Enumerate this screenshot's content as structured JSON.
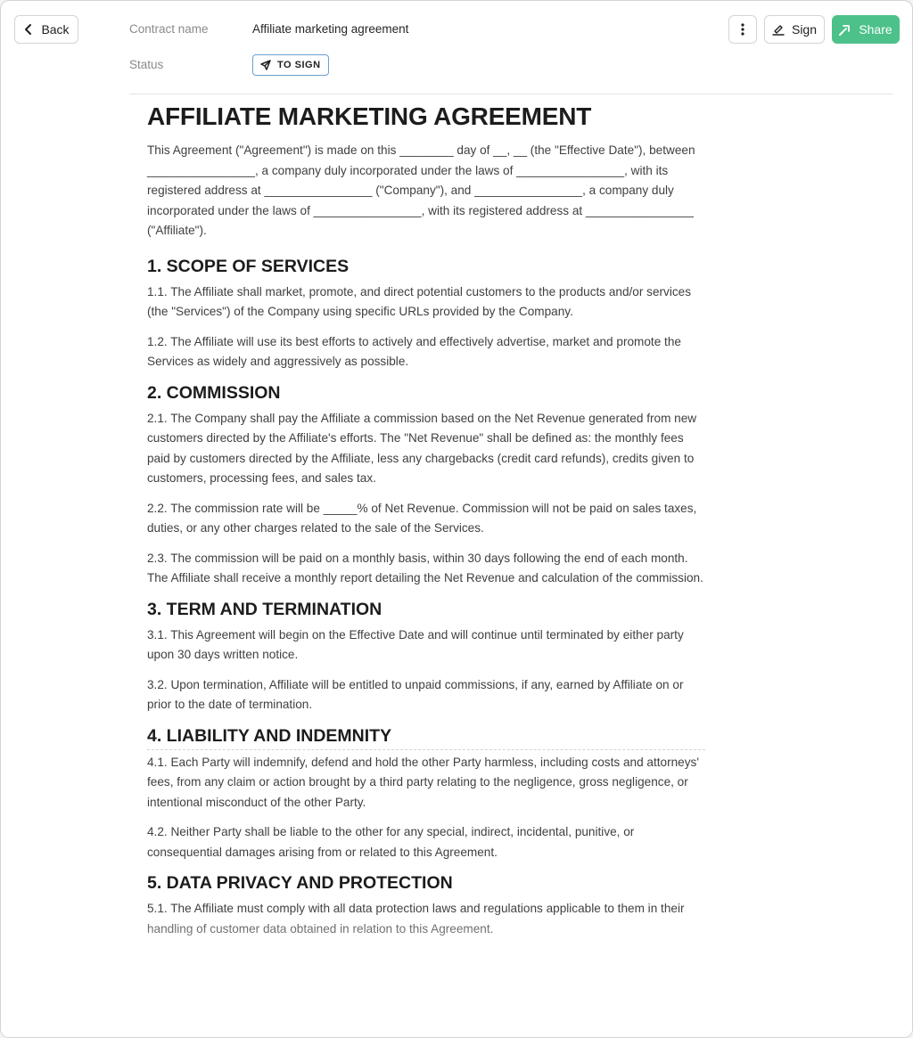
{
  "header": {
    "back_label": "Back",
    "sign_label": "Sign",
    "share_label": "Share",
    "contract_name_label": "Contract name",
    "contract_name_value": "Affiliate marketing agreement",
    "status_label": "Status",
    "status_value": "TO SIGN"
  },
  "colors": {
    "accent": "#4cc18a",
    "status_border": "#6b9fcf"
  },
  "icons": {
    "back": "chevron-left-icon",
    "more": "more-vertical-icon",
    "sign": "signature-pen-icon",
    "share": "share-icon",
    "status": "send-icon"
  },
  "document": {
    "title": "AFFILIATE MARKETING AGREEMENT",
    "intro": "This Agreement (\"Agreement\") is made on this ________ day of __, __ (the \"Effective Date\"), between ________________, a company duly incorporated under the laws of ________________, with its registered address at ________________ (\"Company\"), and ________________, a company duly incorporated under the laws of ________________, with its registered address at ________________ (\"Affiliate\").",
    "sections": [
      {
        "heading": "1. SCOPE OF SERVICES",
        "paragraphs": [
          "1.1. The Affiliate shall market, promote, and direct potential customers to the products and/or services (the \"Services\") of the Company using specific URLs provided by the Company.",
          "1.2. The Affiliate will use its best efforts to actively and effectively advertise, market and promote the Services as widely and aggressively as possible."
        ]
      },
      {
        "heading": "2. COMMISSION",
        "paragraphs": [
          "2.1. The Company shall pay the Affiliate a commission based on the Net Revenue generated from new customers directed by the Affiliate's efforts. The \"Net Revenue\" shall be defined as: the monthly fees paid by customers directed by the Affiliate, less any chargebacks (credit card refunds), credits given to customers, processing fees, and sales tax.",
          "2.2. The commission rate will be _____% of Net Revenue. Commission will not be paid on sales taxes, duties, or any other charges related to the sale of the Services.",
          "2.3. The commission will be paid on a monthly basis, within 30 days following the end of each month. The Affiliate shall receive a monthly report detailing the Net Revenue and calculation of the commission."
        ]
      },
      {
        "heading": "3. TERM AND TERMINATION",
        "paragraphs": [
          "3.1. This Agreement will begin on the Effective Date and will continue until terminated by either party upon 30 days written notice.",
          "3.2. Upon termination, Affiliate will be entitled to unpaid commissions, if any, earned by Affiliate on or prior to the date of termination."
        ]
      },
      {
        "heading": "4. LIABILITY AND INDEMNITY",
        "paragraphs": [
          "4.1. Each Party will indemnify, defend and hold the other Party harmless, including costs and attorneys' fees, from any claim or action brought by a third party relating to the negligence, gross negligence, or intentional misconduct of the other Party.",
          "4.2. Neither Party shall be liable to the other for any special, indirect, incidental, punitive, or consequential damages arising from or related to this Agreement."
        ]
      },
      {
        "heading": "5. DATA PRIVACY AND PROTECTION",
        "paragraphs": [
          "5.1. The Affiliate must comply with all data protection laws and regulations applicable to them in their handling of customer data obtained in relation to this Agreement."
        ]
      }
    ]
  }
}
